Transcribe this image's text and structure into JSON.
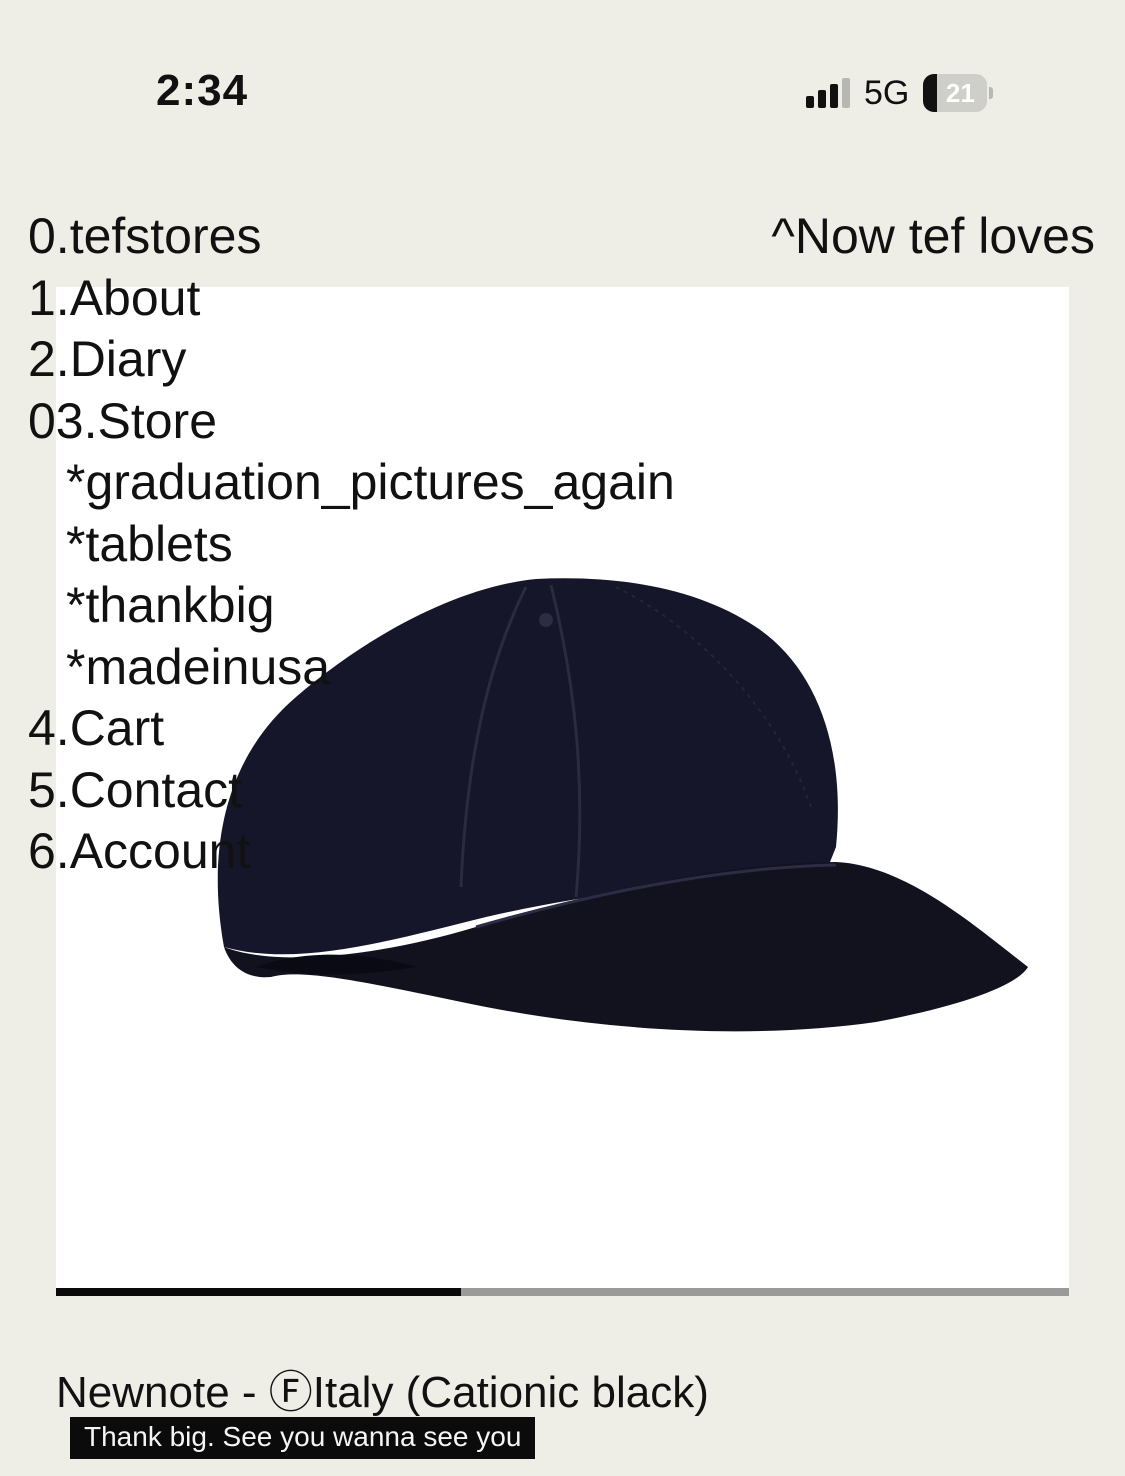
{
  "status_bar": {
    "time": "2:34",
    "network": "5G",
    "battery": "21",
    "battery_level": 0.21,
    "signal_icon": "cellular-signal-icon",
    "battery_icon": "battery-icon"
  },
  "nav": {
    "items": [
      "0.tefstores",
      "1.About",
      "2.Diary",
      "03.Store",
      "*graduation_pictures_again",
      "*tablets",
      "*thankbig",
      "*madeinusa",
      "4.Cart",
      "5.Contact",
      "6.Account"
    ]
  },
  "header_right": "^Now tef loves",
  "carousel": {
    "progress": 0.4
  },
  "product": {
    "title": "Newnote - ⒻItaly (Cationic black)",
    "caption": "Thank big. See you wanna see you",
    "image_icon": "black-cap-image"
  },
  "colors": {
    "background": "#eeede6",
    "panel": "#ffffff",
    "text": "#111111",
    "progress_fill": "#0a0a0a",
    "progress_track": "#9a9a98"
  }
}
